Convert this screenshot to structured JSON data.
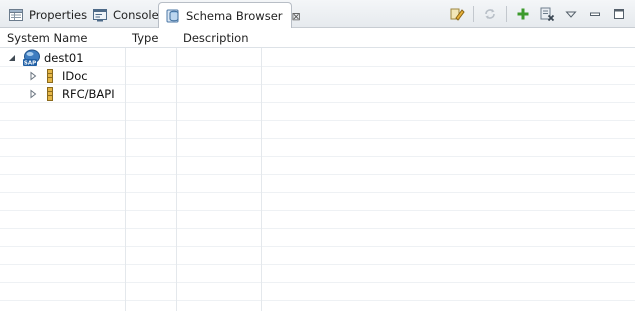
{
  "tabs": [
    {
      "label": "Properties",
      "icon": "properties-icon",
      "active": false
    },
    {
      "label": "Console",
      "icon": "console-icon",
      "active": false
    },
    {
      "label": "Schema Browser",
      "icon": "schema-browser-icon",
      "active": true,
      "close": "⊠"
    }
  ],
  "toolbar": {
    "items": [
      "edit-connection-icon",
      "refresh-icon",
      "add-icon",
      "remove-icon",
      "view-menu-icon",
      "minimize-icon",
      "maximize-icon"
    ]
  },
  "table": {
    "columns": [
      "System Name",
      "Type",
      "Description"
    ]
  },
  "tree": {
    "root": {
      "label": "dest01",
      "icon": "sap-system-icon",
      "badge": "SAP",
      "expanded": true
    },
    "children": [
      {
        "label": "IDoc",
        "icon": "folder-node-icon",
        "expanded": false
      },
      {
        "label": "RFC/BAPI",
        "icon": "folder-node-icon",
        "expanded": false
      }
    ]
  },
  "colors": {
    "accent": "#2f6fb3",
    "header_bg": "#e6eaee",
    "grid": "#eef1f4",
    "add_green": "#3c9a2c"
  }
}
